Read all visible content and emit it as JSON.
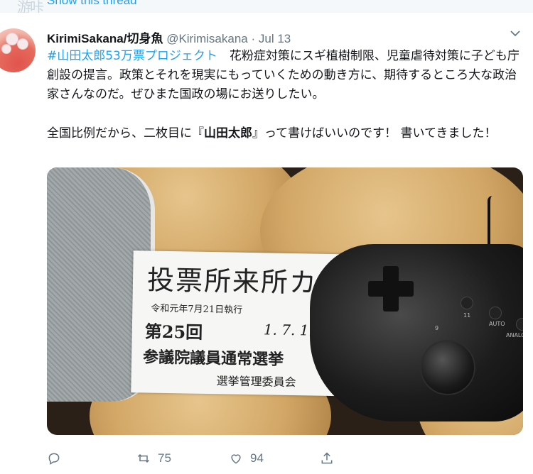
{
  "thread": {
    "show_thread_label": "Show this thread",
    "watermark": "游咔"
  },
  "tweet": {
    "display_name": "KirimiSakana/切身魚",
    "handle": "@Kirimisakana",
    "separator": " · ",
    "date": "Jul 13",
    "hashtag": "#山田太郎53万票プロジェクト",
    "line1_rest": "　花粉症対策にスギ植樹制限、児童虐待対策に子ども庁創設の提言。政策とそれを現実にもっていくための動き方に、期待するところ大な政治家さんなのだ。ぜひまた国政の場にお送りしたい。",
    "para2_pre": "全国比例だから、二枚目に『",
    "para2_bold": "山田太郎",
    "para2_post": "』って書けばいいのです！ 書いてきました！"
  },
  "photo": {
    "card_title": "投票所来所カー",
    "card_date_line": "令和元年7月21日執行",
    "card_number": "第25回",
    "card_handwritten_date": "1. 7. 11",
    "card_election": "参議院議員通常選挙",
    "card_committee": "選挙管理委員会",
    "pad_label_11": "11",
    "pad_label_9": "9",
    "pad_label_auto": "AUTO",
    "pad_label_analog": "ANALOG"
  },
  "actions": {
    "reply_icon": "reply-icon",
    "retweet_icon": "retweet-icon",
    "retweet_count": "75",
    "like_icon": "heart-icon",
    "like_count": "94",
    "share_icon": "share-icon"
  },
  "colors": {
    "link": "#1da1f2",
    "text": "#14171a",
    "muted": "#657786",
    "topbar": "#f5f8fa"
  }
}
